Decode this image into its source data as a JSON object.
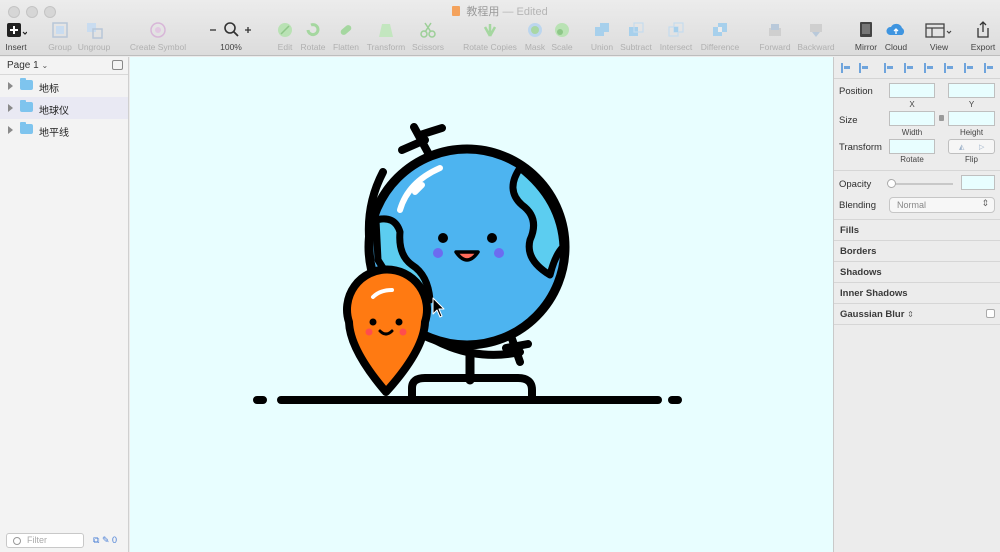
{
  "window": {
    "title": "教程用",
    "status": "— Edited"
  },
  "toolbar": [
    {
      "key": "insert",
      "label": "Insert",
      "on": true
    },
    {
      "key": "group",
      "label": "Group",
      "on": false
    },
    {
      "key": "ungroup",
      "label": "Ungroup",
      "on": false
    },
    {
      "key": "create_symbol",
      "label": "Create Symbol",
      "on": false
    },
    {
      "key": "zoom",
      "label": "100%",
      "on": true
    },
    {
      "key": "edit",
      "label": "Edit",
      "on": false
    },
    {
      "key": "rotate",
      "label": "Rotate",
      "on": false
    },
    {
      "key": "flatten",
      "label": "Flatten",
      "on": false
    },
    {
      "key": "transform",
      "label": "Transform",
      "on": false
    },
    {
      "key": "scissors",
      "label": "Scissors",
      "on": false
    },
    {
      "key": "rotate_copies",
      "label": "Rotate Copies",
      "on": false
    },
    {
      "key": "mask",
      "label": "Mask",
      "on": false
    },
    {
      "key": "scale",
      "label": "Scale",
      "on": false
    },
    {
      "key": "union",
      "label": "Union",
      "on": false
    },
    {
      "key": "subtract",
      "label": "Subtract",
      "on": false
    },
    {
      "key": "intersect",
      "label": "Intersect",
      "on": false
    },
    {
      "key": "difference",
      "label": "Difference",
      "on": false
    },
    {
      "key": "forward",
      "label": "Forward",
      "on": false
    },
    {
      "key": "backward",
      "label": "Backward",
      "on": false
    },
    {
      "key": "mirror",
      "label": "Mirror",
      "on": true
    },
    {
      "key": "cloud",
      "label": "Cloud",
      "on": true
    },
    {
      "key": "view",
      "label": "View",
      "on": true
    },
    {
      "key": "export",
      "label": "Export",
      "on": true
    }
  ],
  "sidebar": {
    "page": "Page 1",
    "layers": [
      {
        "name": "地标",
        "selected": false
      },
      {
        "name": "地球仪",
        "selected": true
      },
      {
        "name": "地平线",
        "selected": false
      }
    ],
    "filter_placeholder": "Filter",
    "footer_count": "0"
  },
  "inspector": {
    "position_label": "Position",
    "x_label": "X",
    "y_label": "Y",
    "size_label": "Size",
    "width_label": "Width",
    "height_label": "Height",
    "transform_label": "Transform",
    "rotate_label": "Rotate",
    "flip_label": "Flip",
    "opacity_label": "Opacity",
    "blending_label": "Blending",
    "blending_value": "Normal",
    "sections": [
      "Fills",
      "Borders",
      "Shadows",
      "Inner Shadows",
      "Gaussian Blur"
    ]
  },
  "colors": {
    "canvas_bg": "#e8feff",
    "globe_blue": "#4db4f0",
    "globe_land": "#5ccdf0",
    "pin_orange": "#ff7a12",
    "accent_blue": "#6fa4dc"
  }
}
